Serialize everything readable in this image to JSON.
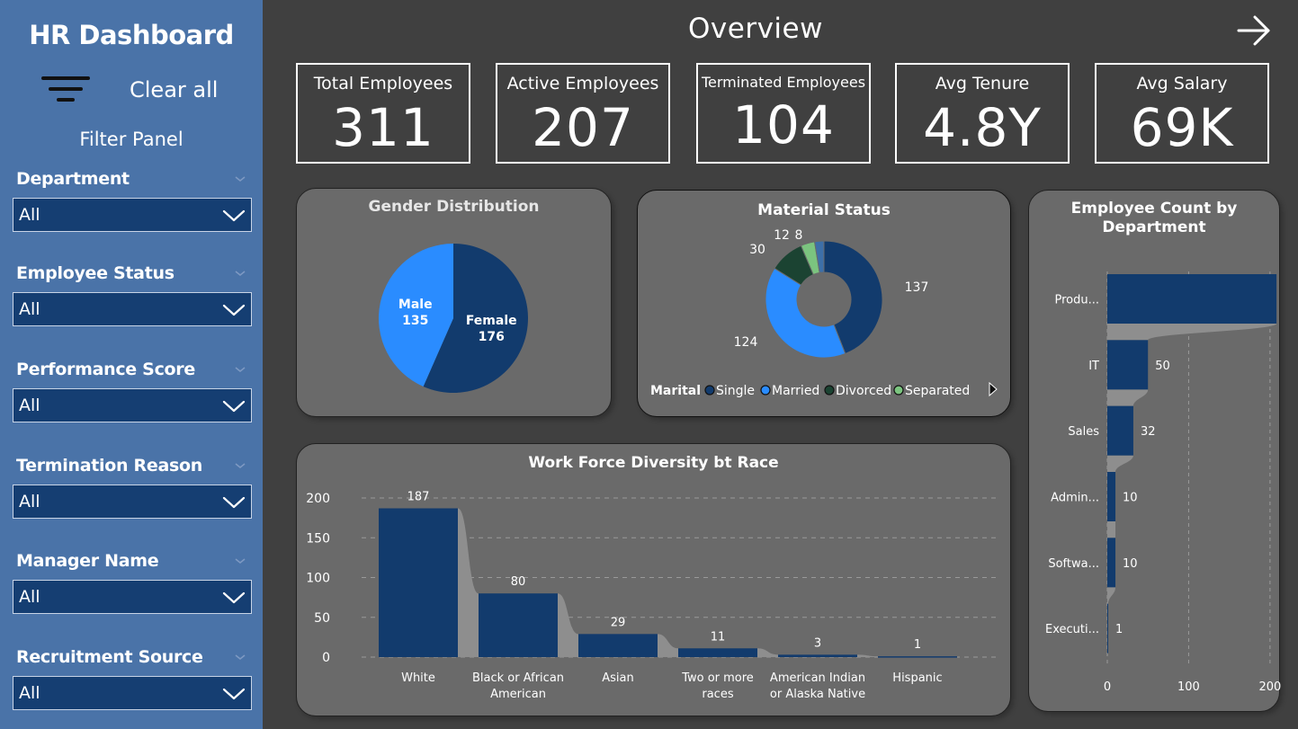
{
  "sidebar": {
    "title": "HR Dashboard",
    "clear_all": "Clear all",
    "panel_label": "Filter Panel",
    "filters": [
      {
        "label": "Department",
        "value": "All"
      },
      {
        "label": "Employee Status",
        "value": "All"
      },
      {
        "label": "Performance Score",
        "value": "All"
      },
      {
        "label": "Termination Reason",
        "value": "All"
      },
      {
        "label": "Manager Name",
        "value": "All"
      },
      {
        "label": "Recruitment Source",
        "value": "All"
      }
    ]
  },
  "header": {
    "title": "Overview",
    "next_icon": "arrow-right-icon"
  },
  "kpis": [
    {
      "label": "Total Employees",
      "value": "311"
    },
    {
      "label": "Active Employees",
      "value": "207"
    },
    {
      "label": "Terminated Employees",
      "value": "104"
    },
    {
      "label": "Avg Tenure",
      "value": "4.8Y"
    },
    {
      "label": "Avg Salary",
      "value": "69K"
    }
  ],
  "colors": {
    "sidebar_bg": "#4a73a8",
    "page_bg": "#404040",
    "card_bg": "#6a6a6a",
    "navy": "#123b6d",
    "blue": "#2a8cff",
    "dark_green": "#1b4332",
    "light_green": "#7bc47f",
    "select_bg": "#153e72"
  },
  "chart_data": [
    {
      "type": "pie",
      "title": "Gender Distribution",
      "categories": [
        "Female",
        "Male"
      ],
      "values": [
        176,
        135
      ],
      "colors": [
        "#123b6d",
        "#2a8cff"
      ]
    },
    {
      "type": "pie",
      "title": "Material Status",
      "donut": true,
      "legend_title": "Marital",
      "categories": [
        "Single",
        "Married",
        "Divorced",
        "Separated",
        ""
      ],
      "legend_entries": [
        "Single",
        "Married",
        "Divorced",
        "Separated"
      ],
      "values": [
        137,
        124,
        30,
        12,
        8
      ],
      "colors": [
        "#123b6d",
        "#2a8cff",
        "#1b4332",
        "#7bc47f",
        "#3d6fa8"
      ]
    },
    {
      "type": "bar",
      "title": "Employee Count by Department",
      "orientation": "horizontal",
      "categories": [
        "Produ...",
        "IT",
        "Sales",
        "Admin...",
        "Softwa...",
        "Executi..."
      ],
      "values": [
        208,
        50,
        32,
        10,
        10,
        1
      ],
      "xticks": [
        0,
        100,
        200
      ],
      "xlim": [
        0,
        230
      ],
      "grid": true
    },
    {
      "type": "bar",
      "title": "Work Force Diversity bt Race",
      "categories": [
        "White",
        "Black or African American",
        "Asian",
        "Two or more races",
        "American Indian or Alaska Native",
        "Hispanic"
      ],
      "category_lines": [
        [
          "White"
        ],
        [
          "Black or African",
          "American"
        ],
        [
          "Asian"
        ],
        [
          "Two or more",
          "races"
        ],
        [
          "American Indian",
          "or Alaska Native"
        ],
        [
          "Hispanic"
        ]
      ],
      "values": [
        187,
        80,
        29,
        11,
        3,
        1
      ],
      "yticks": [
        0,
        50,
        100,
        150,
        200
      ],
      "ylim": [
        0,
        200
      ],
      "grid": true
    }
  ]
}
